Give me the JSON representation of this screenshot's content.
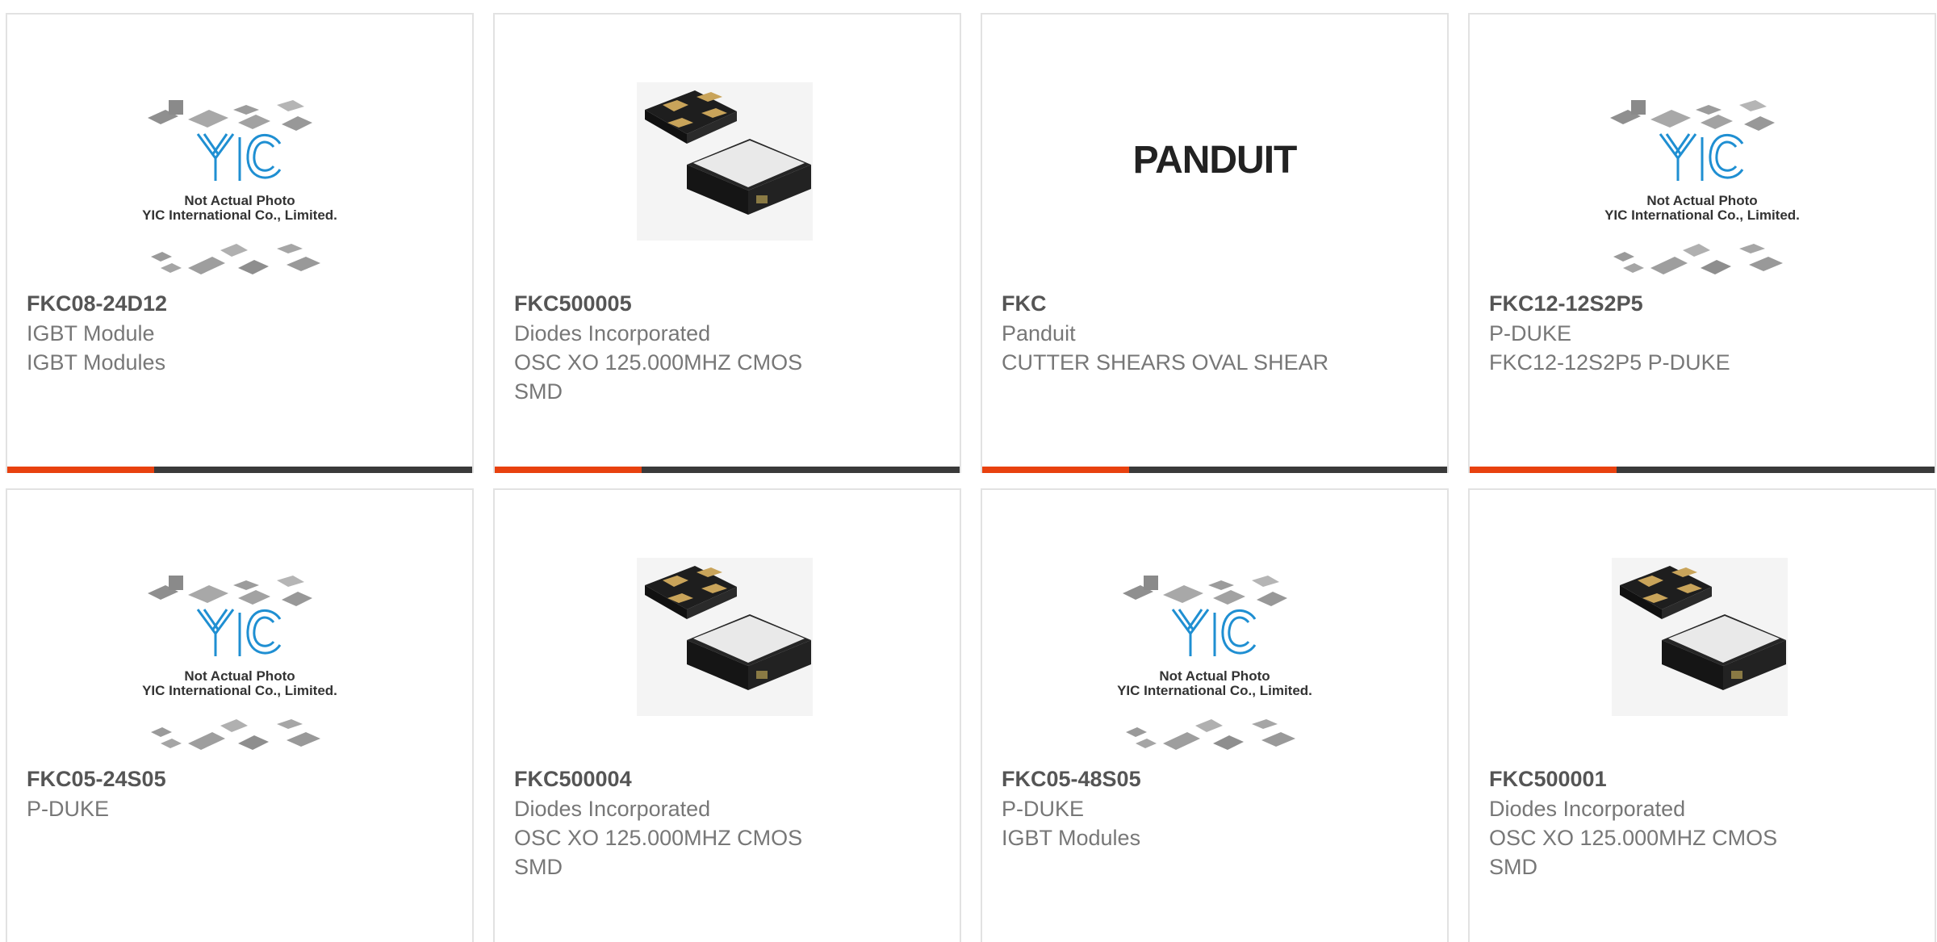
{
  "products": [
    {
      "part": "FKC08-24D12",
      "lines": [
        "IGBT Module",
        "IGBT Modules"
      ],
      "image": "yic-placeholder",
      "image_text": [
        "Not Actual Photo",
        "YIC International Co., Limited."
      ]
    },
    {
      "part": "FKC500005",
      "lines": [
        "Diodes Incorporated",
        "OSC XO 125.000MHZ CMOS",
        "SMD"
      ],
      "image": "oscillator-chip"
    },
    {
      "part": "FKC",
      "lines": [
        "Panduit",
        "CUTTER SHEARS OVAL SHEAR"
      ],
      "image": "panduit-logo",
      "image_text": [
        "PANDUIT"
      ]
    },
    {
      "part": "FKC12-12S2P5",
      "lines": [
        "P-DUKE",
        "FKC12-12S2P5 P-DUKE"
      ],
      "image": "yic-placeholder",
      "image_text": [
        "Not Actual Photo",
        "YIC International Co., Limited."
      ]
    },
    {
      "part": "FKC05-24S05",
      "lines": [
        "P-DUKE"
      ],
      "image": "yic-placeholder",
      "image_text": [
        "Not Actual Photo",
        "YIC International Co., Limited."
      ]
    },
    {
      "part": "FKC500004",
      "lines": [
        "Diodes Incorporated",
        "OSC XO 125.000MHZ CMOS",
        "SMD"
      ],
      "image": "oscillator-chip"
    },
    {
      "part": "FKC05-48S05",
      "lines": [
        "P-DUKE",
        "IGBT Modules"
      ],
      "image": "yic-placeholder",
      "image_text": [
        "Not Actual Photo",
        "YIC International Co., Limited."
      ]
    },
    {
      "part": "FKC500001",
      "lines": [
        "Diodes Incorporated",
        "OSC XO 125.000MHZ CMOS",
        "SMD"
      ],
      "image": "oscillator-chip"
    }
  ],
  "colors": {
    "accent": "#e8410f",
    "bar": "#3a3a3a",
    "part_text": "#555555",
    "line_text": "#777777",
    "card_border": "#e2e2e2",
    "yic_blue": "#1f8fd2"
  }
}
